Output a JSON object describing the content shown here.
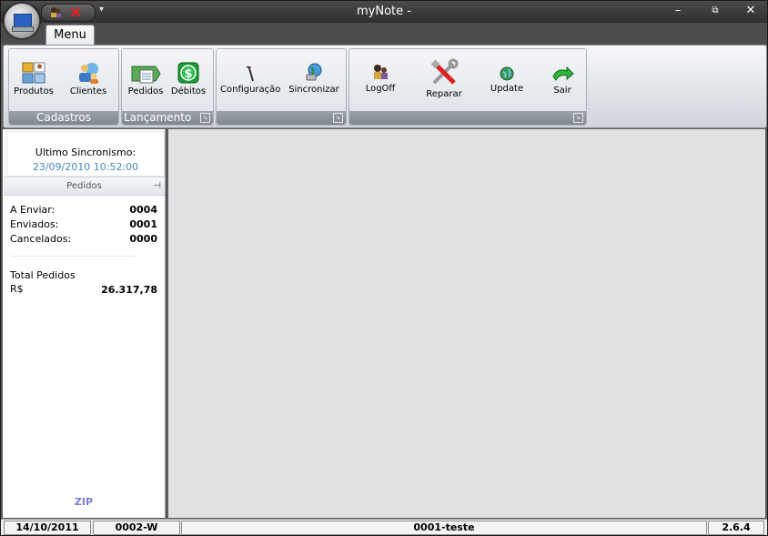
{
  "window": {
    "title": "myNote -"
  },
  "title_controls": {
    "minimize": "–",
    "restore": "⧉",
    "close": "✕"
  },
  "qat": {
    "dropdown": "▾"
  },
  "tabs": [
    {
      "label": "Menu"
    }
  ],
  "ribbon": {
    "groups": [
      {
        "caption": "Cadastros",
        "buttons": [
          {
            "label": "Produtos"
          },
          {
            "label": "Clientes"
          }
        ]
      },
      {
        "caption": "Lançamento",
        "buttons": [
          {
            "label": "Pedidos"
          },
          {
            "label": "Débitos"
          }
        ]
      },
      {
        "caption": "",
        "buttons": [
          {
            "label": "Configuração"
          },
          {
            "label": "Sincronizar"
          }
        ]
      },
      {
        "caption": "",
        "buttons": [
          {
            "label": "LogOff"
          },
          {
            "label": "Reparar"
          },
          {
            "label": "Update"
          },
          {
            "label": "Sair"
          }
        ]
      }
    ]
  },
  "sync": {
    "label": "Ultimo Sincronismo:",
    "value": "23/09/2010 10:52:00"
  },
  "pedidos": {
    "header": "Pedidos",
    "rows": [
      {
        "label": "A Enviar:",
        "value": "0004"
      },
      {
        "label": "Enviados:",
        "value": "0001"
      },
      {
        "label": "Cancelados:",
        "value": "0000"
      }
    ],
    "total_label": "Total Pedidos",
    "currency": "R$",
    "total_value": "26.317,78"
  },
  "zip_label": "ZIP",
  "status": {
    "date": "14/10/2011",
    "code": "0002-W",
    "user": "0001-teste",
    "version": "2.6.4"
  },
  "colors": {
    "accent": "#4a88c2",
    "zip": "#7b7bd8",
    "caption": "#8a9199"
  }
}
